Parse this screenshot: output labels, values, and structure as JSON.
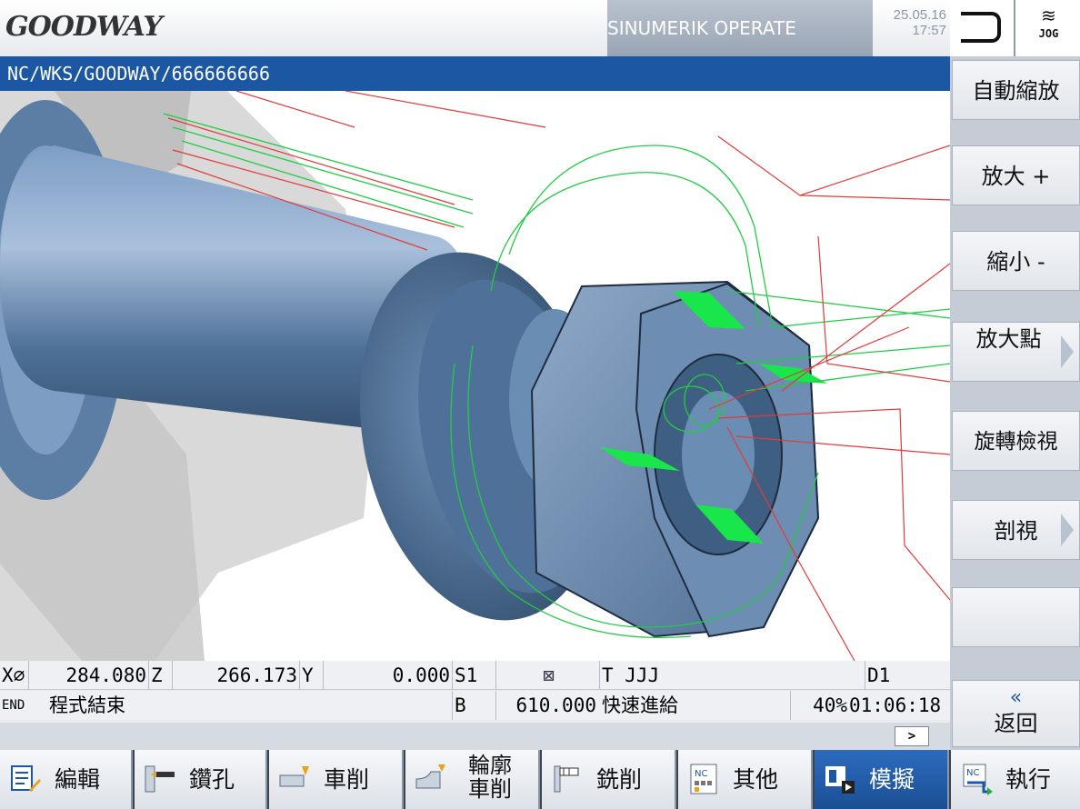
{
  "header": {
    "logo": "GOODWAY",
    "product": "SINUMERIK OPERATE",
    "date": "25.05.16",
    "time": "17:57",
    "mode": "JOG",
    "mode_icon": "wave-icon"
  },
  "path": "NC/WKS/GOODWAY/666666666",
  "status": {
    "x_label": "X⌀",
    "x_value": "284.080",
    "z_label": "Z",
    "z_value": "266.173",
    "y_label": "Y",
    "y_value": "0.000",
    "s_label": "S1",
    "tool": "T JJJ",
    "d_label": "D1",
    "end_label": "END",
    "program_state": "程式結束",
    "b_label": "B",
    "b_value": "610.000",
    "feed_mode": "快速進給",
    "override": "40%",
    "elapsed": "01:06:18",
    "more_button": ">"
  },
  "softkeys_right": [
    {
      "label": "自動縮放"
    },
    {
      "label": "放大 +"
    },
    {
      "label": "縮小 -"
    },
    {
      "label": "放大點"
    },
    {
      "label": "旋轉檢視"
    },
    {
      "label": "剖視"
    },
    {
      "label": ""
    },
    {
      "label": "返回",
      "icon": "double-chevron-left-icon"
    }
  ],
  "softkeys_bottom": [
    {
      "label": "編輯",
      "icon": "edit-icon"
    },
    {
      "label": "鑽孔",
      "icon": "drill-icon"
    },
    {
      "label": "車削",
      "icon": "turning-icon"
    },
    {
      "label": "輪廓車削",
      "icon": "contour-turning-icon"
    },
    {
      "label": "銑削",
      "icon": "milling-icon"
    },
    {
      "label": "其他",
      "icon": "nc-other-icon"
    },
    {
      "label": "模擬",
      "icon": "simulation-icon",
      "active": true
    },
    {
      "label": "執行",
      "icon": "nc-execute-icon"
    }
  ],
  "colors": {
    "path_bar": "#1c57a3",
    "active_key": "#1b4f95",
    "part": "#5b7ea6",
    "toolpath_green": "#22cc44",
    "toolpath_red": "#e23a3a"
  }
}
